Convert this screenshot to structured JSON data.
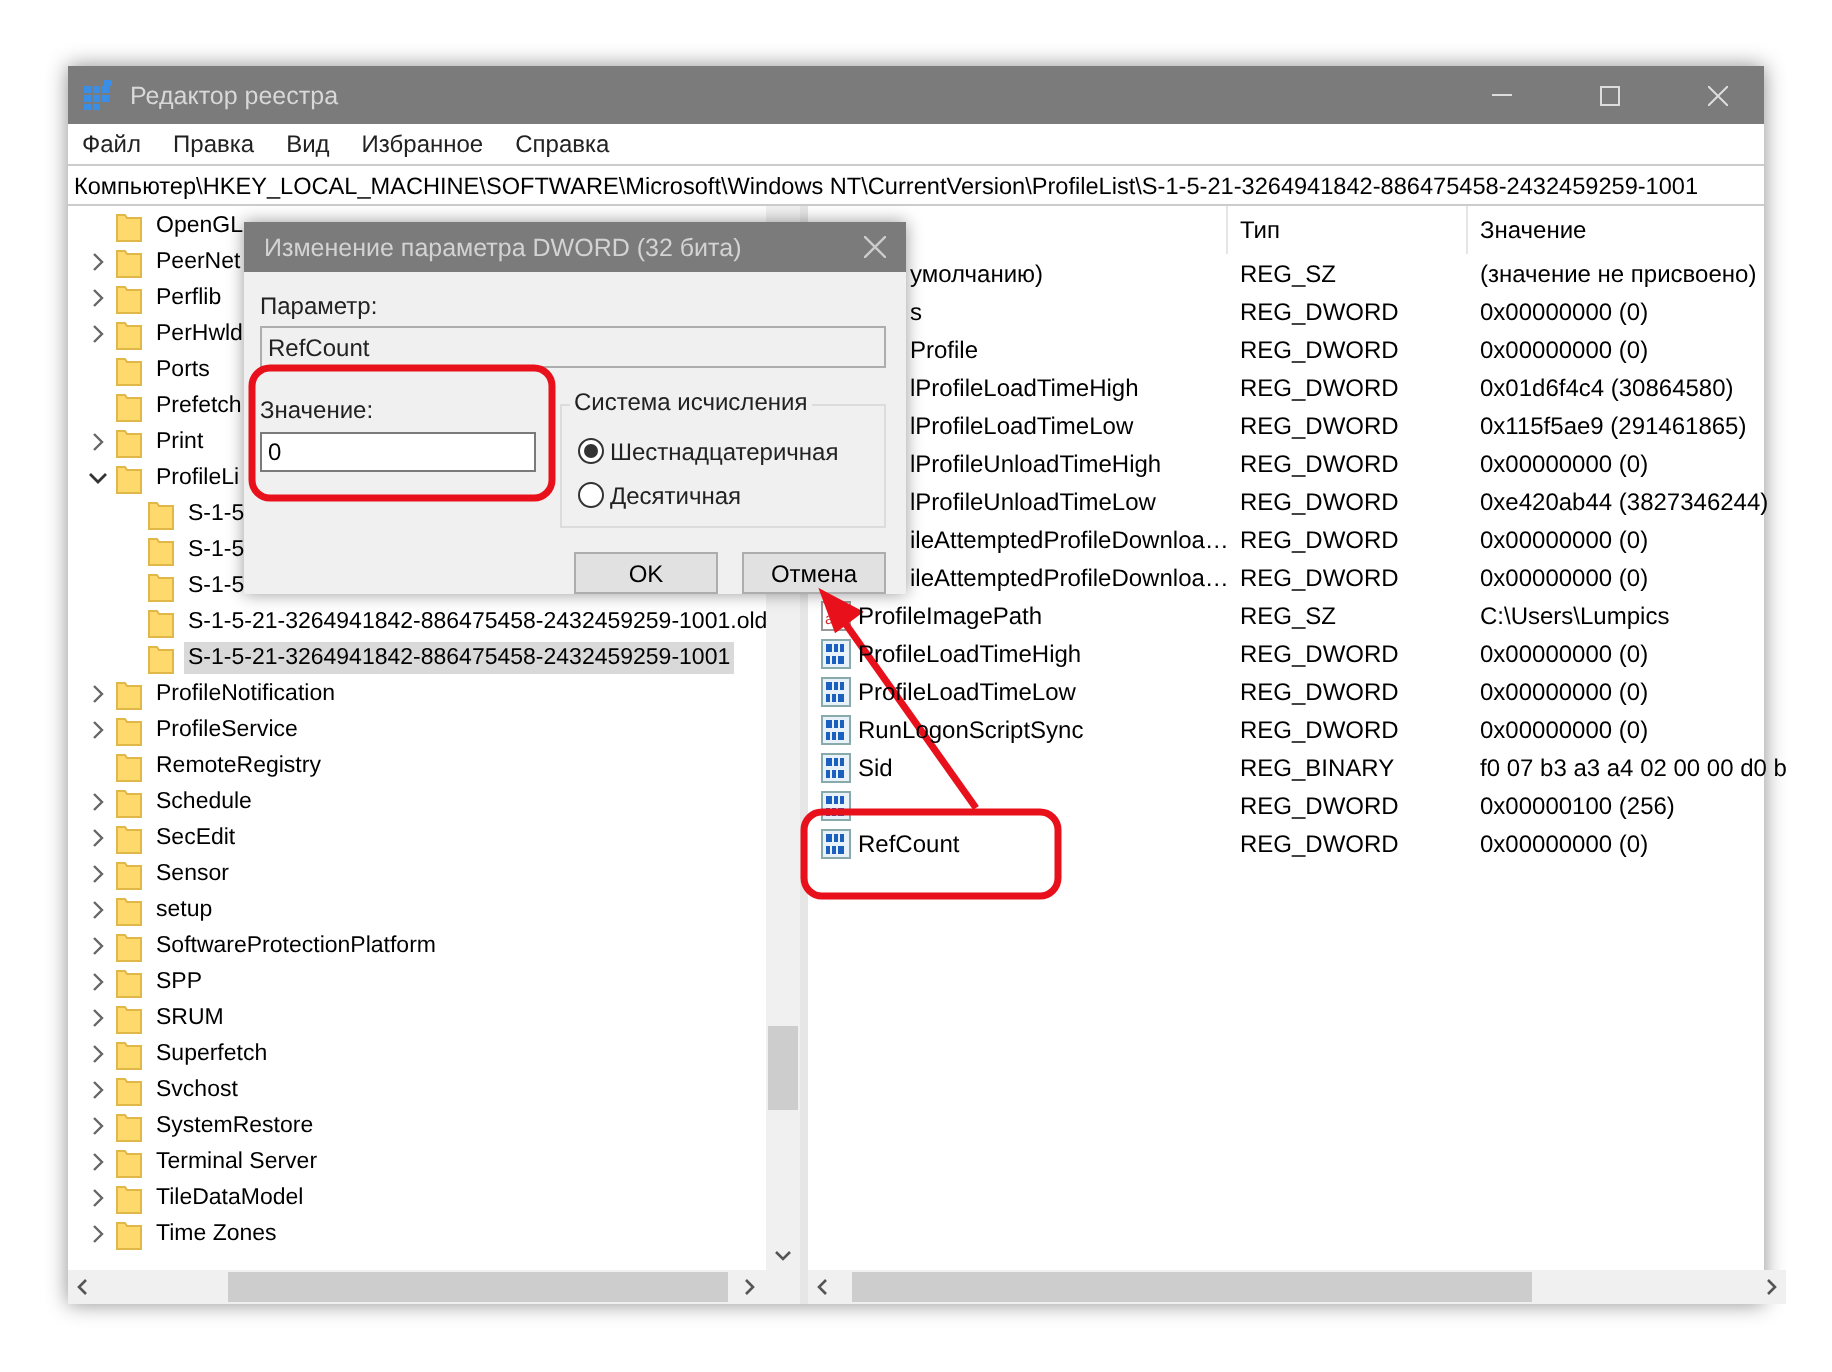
{
  "window": {
    "title": "Редактор реестра"
  },
  "menu": [
    "Файл",
    "Правка",
    "Вид",
    "Избранное",
    "Справка"
  ],
  "address": "Компьютер\\HKEY_LOCAL_MACHINE\\SOFTWARE\\Microsoft\\Windows NT\\CurrentVersion\\ProfileList\\S-1-5-21-3264941842-886475458-2432459259-1001",
  "tree": [
    {
      "label": "OpenGL",
      "has_children": false,
      "selected": false
    },
    {
      "label": "PeerNet",
      "has_children": true,
      "expanded": false,
      "selected": false
    },
    {
      "label": "Perflib",
      "has_children": true,
      "expanded": false,
      "selected": false
    },
    {
      "label": "PerHwld",
      "has_children": true,
      "expanded": false,
      "selected": false
    },
    {
      "label": "Ports",
      "has_children": false,
      "selected": false
    },
    {
      "label": "Prefetch",
      "has_children": false,
      "selected": false
    },
    {
      "label": "Print",
      "has_children": true,
      "expanded": false,
      "selected": false
    },
    {
      "label": "ProfileLi",
      "has_children": true,
      "expanded": true,
      "selected": false,
      "children": [
        {
          "label": "S-1-5",
          "has_children": false,
          "selected": false
        },
        {
          "label": "S-1-5",
          "has_children": false,
          "selected": false
        },
        {
          "label": "S-1-5",
          "has_children": false,
          "selected": false
        },
        {
          "label": "S-1-5-21-3264941842-886475458-2432459259-1001.old",
          "has_children": false,
          "selected": false
        },
        {
          "label": "S-1-5-21-3264941842-886475458-2432459259-1001",
          "has_children": false,
          "selected": true
        }
      ]
    },
    {
      "label": "ProfileNotification",
      "has_children": true,
      "expanded": false,
      "selected": false
    },
    {
      "label": "ProfileService",
      "has_children": true,
      "expanded": false,
      "selected": false
    },
    {
      "label": "RemoteRegistry",
      "has_children": false,
      "selected": false
    },
    {
      "label": "Schedule",
      "has_children": true,
      "expanded": false,
      "selected": false
    },
    {
      "label": "SecEdit",
      "has_children": true,
      "expanded": false,
      "selected": false
    },
    {
      "label": "Sensor",
      "has_children": true,
      "expanded": false,
      "selected": false
    },
    {
      "label": "setup",
      "has_children": true,
      "expanded": false,
      "selected": false
    },
    {
      "label": "SoftwareProtectionPlatform",
      "has_children": true,
      "expanded": false,
      "selected": false
    },
    {
      "label": "SPP",
      "has_children": true,
      "expanded": false,
      "selected": false
    },
    {
      "label": "SRUM",
      "has_children": true,
      "expanded": false,
      "selected": false
    },
    {
      "label": "Superfetch",
      "has_children": true,
      "expanded": false,
      "selected": false
    },
    {
      "label": "Svchost",
      "has_children": true,
      "expanded": false,
      "selected": false
    },
    {
      "label": "SystemRestore",
      "has_children": true,
      "expanded": false,
      "selected": false
    },
    {
      "label": "Terminal Server",
      "has_children": true,
      "expanded": false,
      "selected": false
    },
    {
      "label": "TileDataModel",
      "has_children": true,
      "expanded": false,
      "selected": false
    },
    {
      "label": "Time Zones",
      "has_children": true,
      "expanded": false,
      "selected": false
    }
  ],
  "list": {
    "columns": [
      "Тип",
      "Значение"
    ],
    "rows": [
      {
        "name": "умолчанию)",
        "type": "REG_SZ",
        "value": "(значение не присвоено)"
      },
      {
        "name": "s",
        "type": "REG_DWORD",
        "value": "0x00000000 (0)"
      },
      {
        "name": "Profile",
        "type": "REG_DWORD",
        "value": "0x00000000 (0)"
      },
      {
        "name": "lProfileLoadTimeHigh",
        "type": "REG_DWORD",
        "value": "0x01d6f4c4 (30864580)"
      },
      {
        "name": "lProfileLoadTimeLow",
        "type": "REG_DWORD",
        "value": "0x115f5ae9 (291461865)"
      },
      {
        "name": "lProfileUnloadTimeHigh",
        "type": "REG_DWORD",
        "value": "0x00000000 (0)"
      },
      {
        "name": "lProfileUnloadTimeLow",
        "type": "REG_DWORD",
        "value": "0xe420ab44 (3827346244)"
      },
      {
        "name": "ileAttemptedProfileDownloa…",
        "type": "REG_DWORD",
        "value": "0x00000000 (0)"
      },
      {
        "name": "ileAttemptedProfileDownloa…",
        "type": "REG_DWORD",
        "value": "0x00000000 (0)"
      },
      {
        "kind": "string",
        "name": "ProfileImagePath",
        "type": "REG_SZ",
        "value": "C:\\Users\\Lumpics"
      },
      {
        "kind": "binary",
        "name": "ProfileLoadTimeHigh",
        "type": "REG_DWORD",
        "value": "0x00000000 (0)"
      },
      {
        "kind": "binary",
        "name": "ProfileLoadTimeLow",
        "type": "REG_DWORD",
        "value": "0x00000000 (0)"
      },
      {
        "kind": "binary",
        "name": "RunLogonScriptSync",
        "type": "REG_DWORD",
        "value": "0x00000000 (0)"
      },
      {
        "kind": "binary",
        "name": "Sid",
        "type": "REG_BINARY",
        "value": "f0 07 b3 a3 a4 02 00 00 d0 b"
      },
      {
        "kind": "binary",
        "type": "REG_DWORD",
        "value": "0x00000100 (256)"
      },
      {
        "kind": "binary",
        "name": "RefCount",
        "type": "REG_DWORD",
        "value": "0x00000000 (0)"
      }
    ]
  },
  "dialog": {
    "title": "Изменение параметра DWORD (32 бита)",
    "param_label": "Параметр:",
    "param_value": "RefCount",
    "value_label": "Значение:",
    "value": "0",
    "base_label": "Система исчисления",
    "bases": [
      {
        "label": "Шестнадцатеричная",
        "selected": true
      },
      {
        "label": "Десятичная",
        "selected": false
      }
    ],
    "buttons": [
      "OK",
      "Отмена"
    ]
  }
}
